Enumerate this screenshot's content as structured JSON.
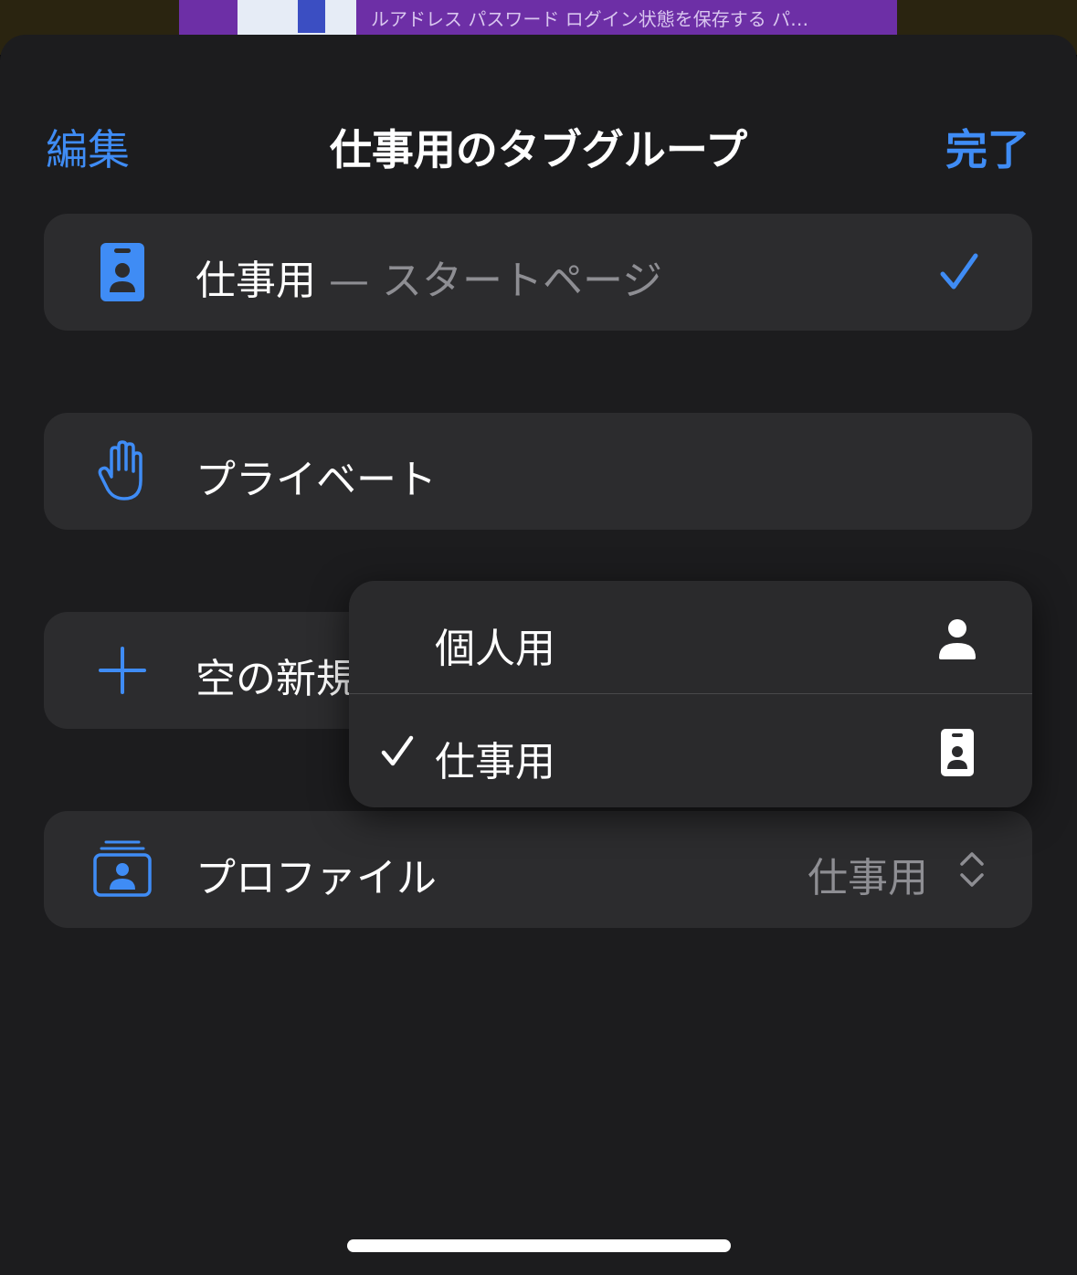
{
  "background": {
    "preview_text": "ルアドレス パスワード ログイン状態を保存する パ…"
  },
  "nav": {
    "edit_label": "編集",
    "title": "仕事用のタブグループ",
    "done_label": "完了"
  },
  "groups": {
    "work": {
      "label": "仕事用",
      "sublabel": " — スタートページ",
      "icon": "id-badge-icon",
      "selected": true
    },
    "private": {
      "label": "プライベート",
      "icon": "hand-raised-icon"
    },
    "new_group": {
      "label": "空の新規",
      "icon": "plus-icon"
    }
  },
  "profile": {
    "label": "プロファイル",
    "value": "仕事用",
    "icon": "profiles-stack-icon"
  },
  "profile_menu": {
    "items": [
      {
        "label": "個人用",
        "icon": "person-icon",
        "checked": false
      },
      {
        "label": "仕事用",
        "icon": "id-badge-icon",
        "checked": true
      }
    ]
  },
  "colors": {
    "accent": "#3f8cf5",
    "sheet_bg": "#1c1c1e",
    "card_bg": "#2c2c2e",
    "secondary_text": "#8e8e93"
  }
}
